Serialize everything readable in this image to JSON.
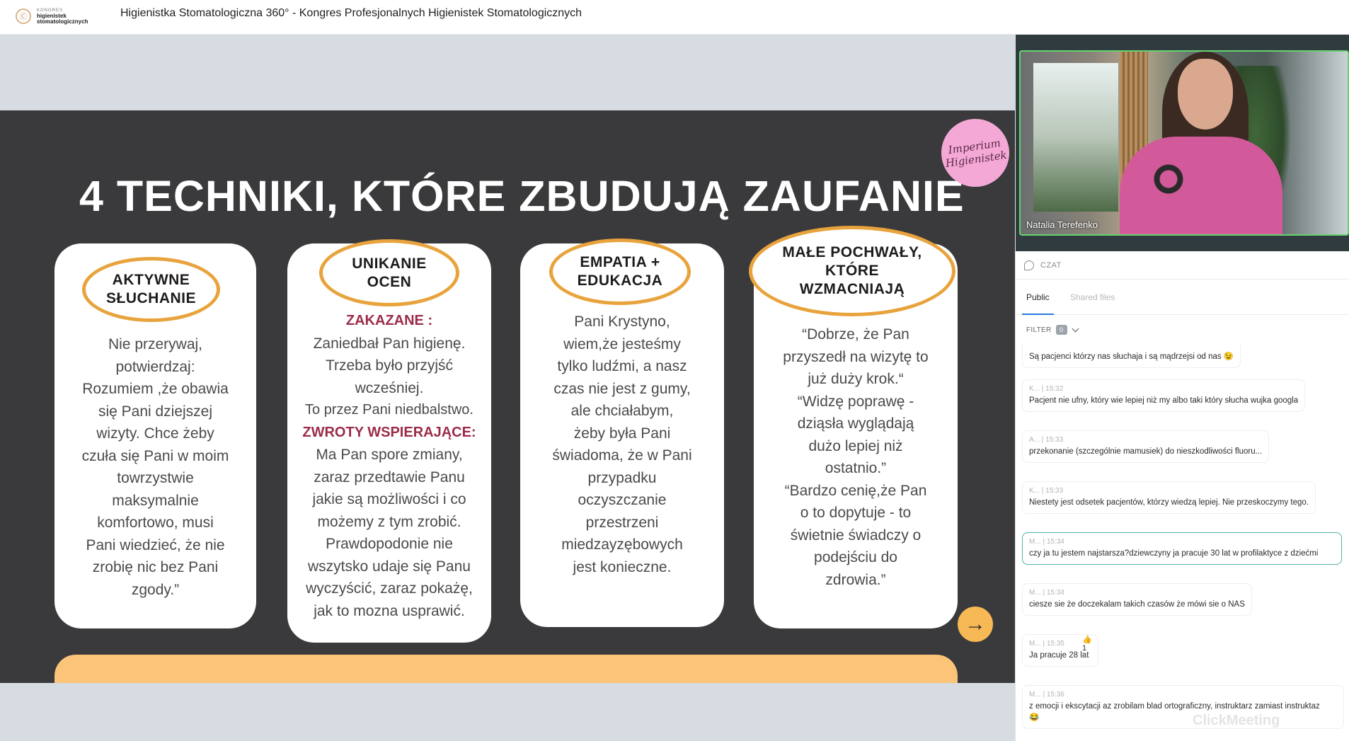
{
  "header": {
    "logo_line1": "KONGRES",
    "logo_line2": "higienistek",
    "logo_line3": "stomatologicznych",
    "title": "Higienistka Stomatologiczna 360° - Kongres Profesjonalnych Higienistek Stomatologicznych"
  },
  "slide": {
    "title": "4 TECHNIKI, KTÓRE ZBUDUJĄ ZAUFANIE",
    "badge": "Imperium Higienistek",
    "cards": [
      {
        "heading": [
          "AKTYWNE",
          "SŁUCHANIE"
        ],
        "lines": [
          "Nie przerywaj,",
          "potwierdzaj:",
          "Rozumiem ,że obawia",
          "się Pani dziejszej",
          "wizyty. Chce żeby",
          "czuła się Pani w moim",
          "towrzystwie",
          "maksymalnie",
          "komfortowo, musi",
          "Pani wiedzieć, że nie",
          "zrobię nic bez Pani",
          "zgody.”"
        ]
      },
      {
        "heading": [
          "UNIKANIE",
          "OCEN"
        ],
        "red1": "ZAKAZANE :",
        "lines1": [
          "Zaniedbał Pan higienę.",
          "Trzeba było przyjść",
          "wcześniej.",
          "To przez Pani niedbalstwo."
        ],
        "red2": "ZWROTY WSPIERAJĄCE:",
        "lines2": [
          "Ma Pan spore zmiany,",
          "zaraz przedtawie Panu",
          "jakie są możliwości i co",
          "możemy z tym zrobić.",
          "Prawdopodonie nie",
          "wszytsko udaje się Panu",
          "wyczyścić, zaraz pokażę,",
          "jak to mozna usprawić."
        ]
      },
      {
        "heading": [
          "EMPATIA +",
          "EDUKACJA"
        ],
        "lines": [
          "Pani Krystyno,",
          "wiem,że jesteśmy",
          "tylko ludźmi, a nasz",
          "czas nie jest z gumy,",
          "ale chciałabym,",
          "żeby była Pani",
          "świadoma, że w Pani",
          "przypadku",
          "oczyszczanie",
          "przestrzeni",
          "miedzayzębowych",
          "jest konieczne."
        ]
      },
      {
        "heading": [
          "MAŁE POCHWAŁY,",
          "KTÓRE",
          "WZMACNIAJĄ"
        ],
        "lines": [
          "“Dobrze, że Pan",
          "przyszedł na wizytę to",
          "już duży krok.“",
          "“Widzę poprawę -",
          "dziąsła wyglądają",
          "dużo lepiej niż",
          "ostatnio.”",
          "“Bardzo cenię,że Pan",
          "o to dopytuje - to",
          "świetnie świadczy o",
          "podejściu do",
          "zdrowia.”"
        ]
      }
    ],
    "next_arrow": "→"
  },
  "video": {
    "speaker_name": "Natalia Terefenko"
  },
  "chat": {
    "title": "CZAT",
    "tabs": [
      "Public",
      "Shared files"
    ],
    "filter_label": "FILTER",
    "filter_count": "0",
    "messages": [
      {
        "meta": "",
        "text": "Są pacjenci którzy nas słuchaja i są mądrzejsi od nas 😉"
      },
      {
        "meta": "K...  |  15:32",
        "text": "Pacjent nie ufny, który wie lepiej niż my albo taki który słucha wujka googla"
      },
      {
        "meta": "A...  |  15:33",
        "text": "przekonanie (szczególnie mamusiek) do nieszkodliwości fluoru..."
      },
      {
        "meta": "K...  |  15:33",
        "text": "Niestety jest odsetek pacjentów, którzy wiedzą lepiej. Nie przeskoczymy tego."
      },
      {
        "meta": "M...  |  15:34",
        "text": "czy ja tu jestem najstarsza?dziewczyny ja pracuje 30 lat w profilaktyce z dziećmi"
      },
      {
        "meta": "M...  |  15:34",
        "text": "ciesze sie że doczekalam takich czasów że mówi sie o NAS"
      },
      {
        "meta": "M...  |  15:35",
        "text": "Ja pracuje 28 lat",
        "reaction": "👍 1"
      },
      {
        "meta": "M...  |  15:36",
        "text": "z emocji i ekscytacji az zrobilam blad ortograficzny, instruktarz zamiast instruktaz",
        "text2": "😂"
      }
    ],
    "watermark": "ClickMeeting"
  },
  "colors": {
    "slide_bg": "#3a3a3c",
    "accent_orange": "#e8a33c",
    "accent_red": "#9b2c4a",
    "highlight_border": "#4fb3a5",
    "badge_pink": "#f4a8d6"
  }
}
